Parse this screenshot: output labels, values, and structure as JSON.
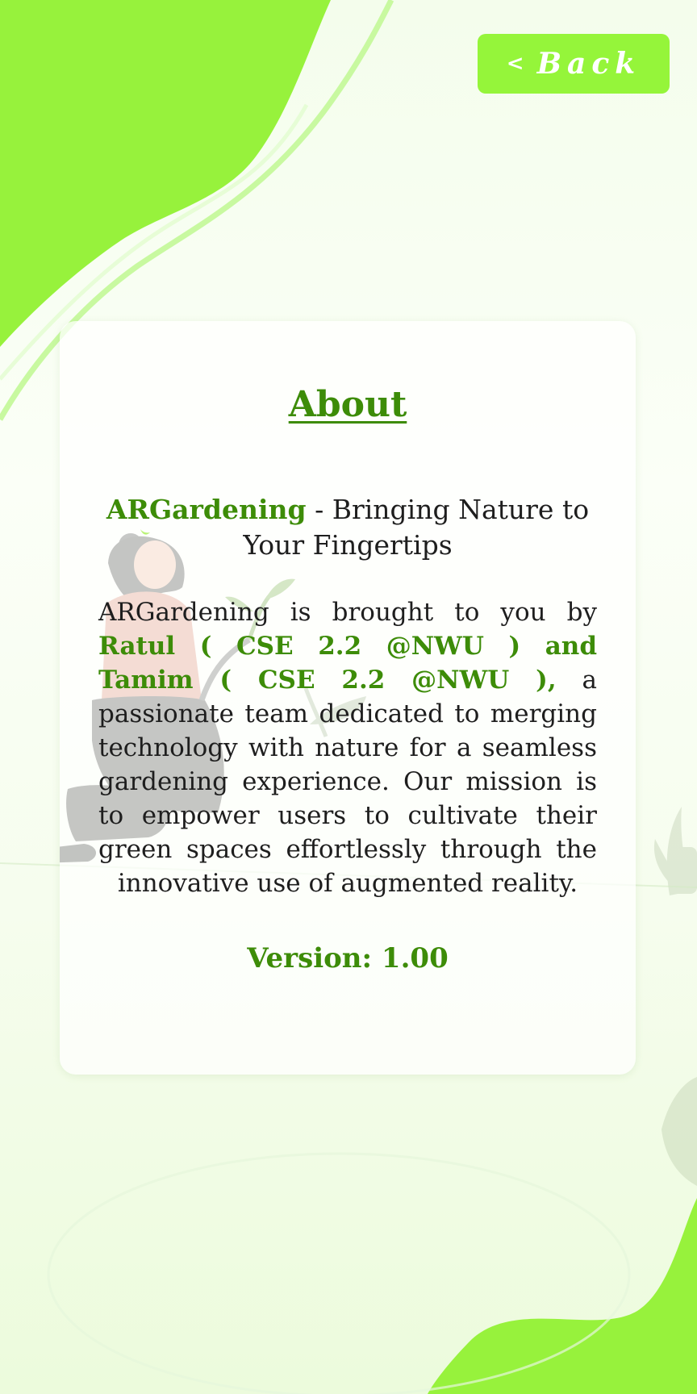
{
  "header": {
    "back_label": "Back",
    "back_chevron": "<"
  },
  "about": {
    "title": "About",
    "app_name": "ARGardening",
    "tagline_rest": " - Bringing Nature to Your Fingertips",
    "intro": "ARGardening is brought to you by ",
    "authors": "Ratul ( CSE 2.2 @NWU ) and Tamim ( CSE 2.2 @NWU ),",
    "description": " a passionate team dedicated to merging technology with nature for a seamless gardening experience. Our mission is to empower users to cultivate their green spaces effortlessly through the innovative use of augmented reality.",
    "version": "Version: 1.00"
  },
  "colors": {
    "accent": "#95f53a",
    "heading_green": "#3d8c08",
    "text": "#1e1e1e"
  },
  "icons": [
    "chevron-left-icon",
    "gardener-illustration"
  ]
}
